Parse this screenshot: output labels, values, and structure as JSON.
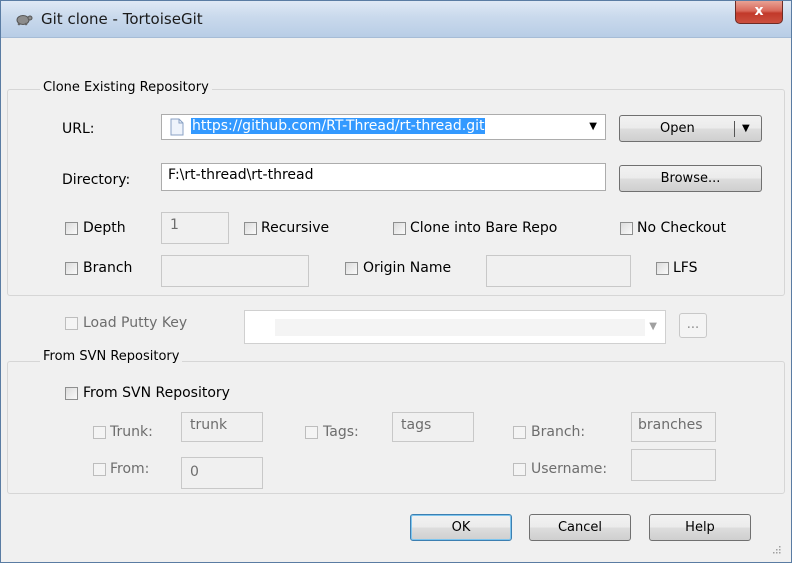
{
  "window": {
    "title": "Git clone - TortoiseGit",
    "close_label": "x"
  },
  "clone_group": {
    "title": "Clone Existing Repository",
    "url_label": "URL:",
    "url_value": "https://github.com/RT-Thread/rt-thread.git",
    "open_label": "Open",
    "directory_label": "Directory:",
    "directory_value": "F:\\rt-thread\\rt-thread",
    "browse_label": "Browse...",
    "depth_label": "Depth",
    "depth_value": "1",
    "recursive_label": "Recursive",
    "bare_label": "Clone into Bare Repo",
    "nocheckout_label": "No Checkout",
    "branch_label": "Branch",
    "branch_value": "",
    "origin_label": "Origin Name",
    "origin_value": "",
    "lfs_label": "LFS"
  },
  "putty": {
    "label": "Load Putty Key",
    "value": "",
    "browse_label": "..."
  },
  "svn_group": {
    "title": "From SVN Repository",
    "from_svn_label": "From SVN Repository",
    "trunk_label": "Trunk:",
    "trunk_value": "trunk",
    "tags_label": "Tags:",
    "tags_value": "tags",
    "branch_label": "Branch:",
    "branch_value": "branches",
    "from_label": "From:",
    "from_value": "0",
    "username_label": "Username:",
    "username_value": ""
  },
  "buttons": {
    "ok": "OK",
    "cancel": "Cancel",
    "help": "Help"
  },
  "icons": {
    "title": "tortoise-icon",
    "file": "file-icon",
    "dropdown": "chevron-down-icon"
  }
}
